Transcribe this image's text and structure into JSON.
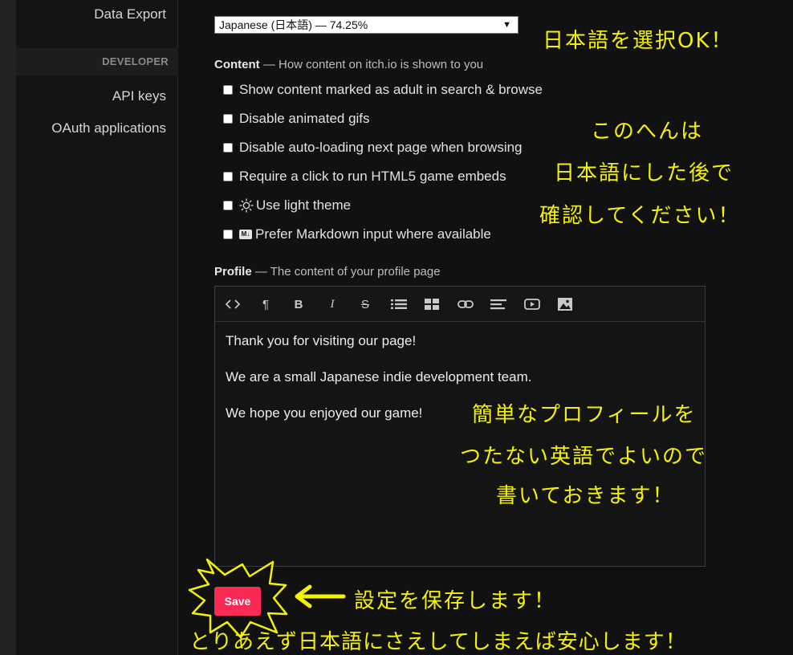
{
  "sidebar": {
    "data_export": "Data Export",
    "developer_section": "DEVELOPER",
    "api_keys": "API keys",
    "oauth_applications": "OAuth applications"
  },
  "language": {
    "selected": "Japanese (日本語) — 74.25%"
  },
  "content": {
    "heading": "Content",
    "description": "— How content on itch.io is shown to you",
    "options": [
      {
        "label": "Show content marked as adult in search & browse",
        "checked": false
      },
      {
        "label": "Disable animated gifs",
        "checked": false
      },
      {
        "label": "Disable auto-loading next page when browsing",
        "checked": false
      },
      {
        "label": "Require a click to run HTML5 game embeds",
        "checked": false
      },
      {
        "label": "Use light theme",
        "checked": false,
        "icon": "sun-icon"
      },
      {
        "label": "Prefer Markdown input where available",
        "checked": false,
        "icon": "markdown-icon"
      }
    ]
  },
  "profile": {
    "heading": "Profile",
    "description": "— The content of your profile page",
    "toolbar": [
      "code-icon",
      "paragraph-icon",
      "bold-icon",
      "italic-icon",
      "strikethrough-icon",
      "bullet-list-icon",
      "table-icon",
      "link-icon",
      "align-icon",
      "video-icon",
      "image-icon"
    ],
    "paragraphs": [
      "Thank you for visiting our page!",
      "We are a small Japanese indie development team.",
      "We hope you enjoyed our game!"
    ]
  },
  "save_label": "Save",
  "annotations": {
    "language_ok": "日本語を選択OK！",
    "content_note": [
      "このへんは",
      "日本語にした後で",
      "確認してください！"
    ],
    "profile_note": [
      "簡単なプロフィールを",
      "つたない英語でよいので",
      "書いておきます！"
    ],
    "save_note": "設定を保存します！",
    "bottom_note": "とりあえず日本語にさえしてしまえば安心します！"
  },
  "colors": {
    "save_button": "#fa2a56",
    "annotation": "#f4f200",
    "background": "#111111"
  }
}
